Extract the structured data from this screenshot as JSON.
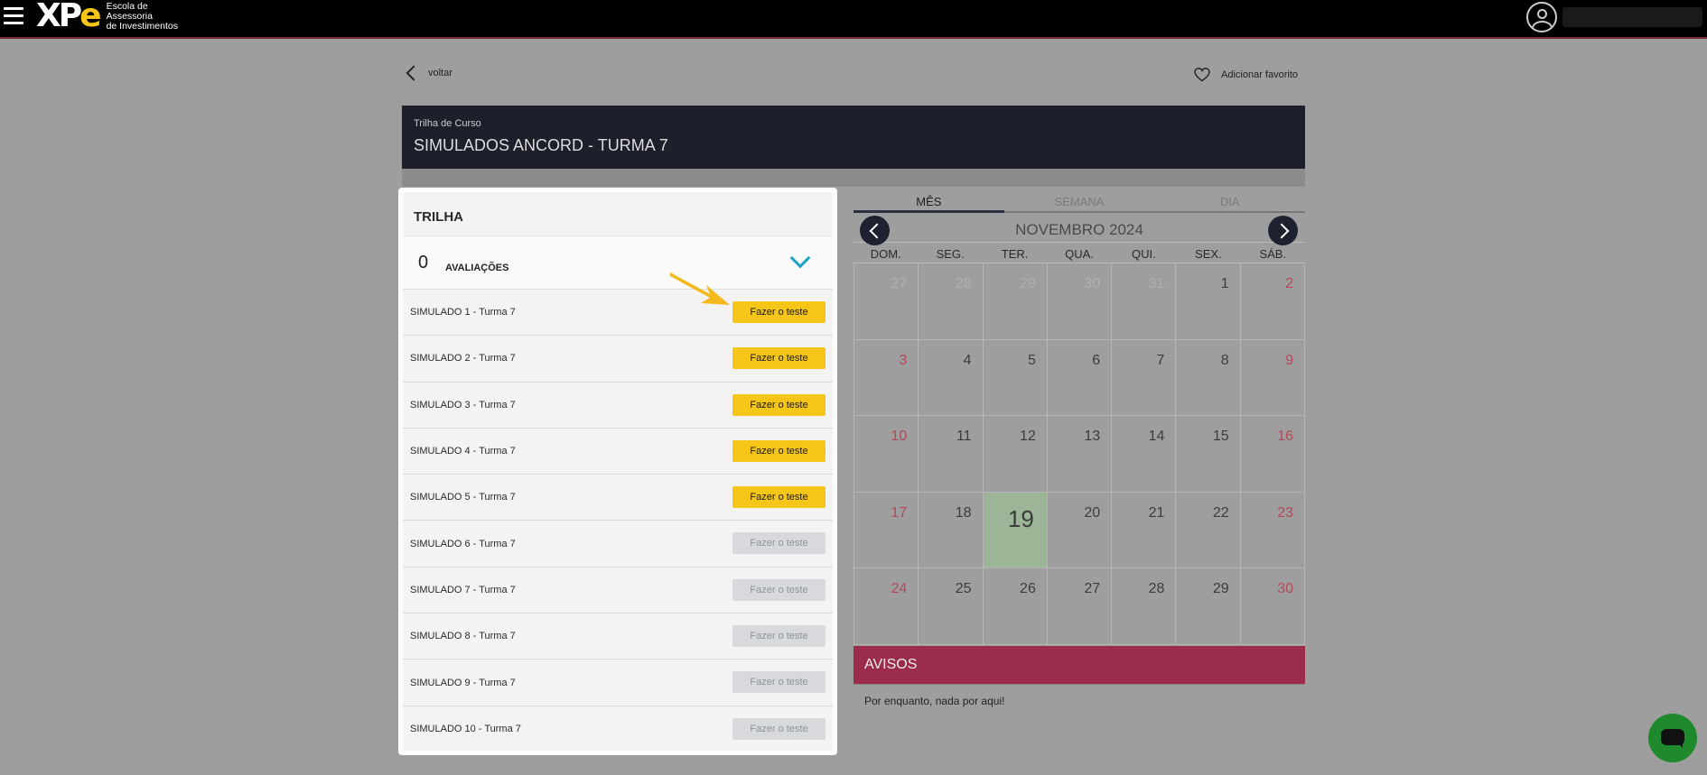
{
  "header": {
    "logo_text": "XPe",
    "logo_subtitle_lines": [
      "Escola de",
      "Assessoria",
      "de Investimentos"
    ]
  },
  "nav": {
    "back_label": "voltar",
    "favorite_label": "Adicionar favorito"
  },
  "course": {
    "subtitle": "Trilha de Curso",
    "title": "SIMULADOS ANCORD - TURMA 7"
  },
  "trilha": {
    "heading": "TRILHA",
    "avaliacoes_count": "0",
    "avaliacoes_label": "AVALIAÇÕES",
    "items": [
      {
        "name": "SIMULADO 1 - Turma 7",
        "button": "Fazer o teste",
        "enabled": true
      },
      {
        "name": "SIMULADO 2 - Turma 7",
        "button": "Fazer o teste",
        "enabled": true
      },
      {
        "name": "SIMULADO 3 - Turma 7",
        "button": "Fazer o teste",
        "enabled": true
      },
      {
        "name": "SIMULADO 4 - Turma 7",
        "button": "Fazer o teste",
        "enabled": true
      },
      {
        "name": "SIMULADO 5 - Turma 7",
        "button": "Fazer o teste",
        "enabled": true
      },
      {
        "name": "SIMULADO 6 - Turma 7",
        "button": "Fazer o teste",
        "enabled": false
      },
      {
        "name": "SIMULADO 7 - Turma 7",
        "button": "Fazer o teste",
        "enabled": false
      },
      {
        "name": "SIMULADO 8 - Turma 7",
        "button": "Fazer o teste",
        "enabled": false
      },
      {
        "name": "SIMULADO 9 - Turma 7",
        "button": "Fazer o teste",
        "enabled": false
      },
      {
        "name": "SIMULADO 10 - Turma 7",
        "button": "Fazer o teste",
        "enabled": false
      }
    ]
  },
  "calendar": {
    "tabs": [
      "MÊS",
      "SEMANA",
      "DIA"
    ],
    "active_tab": "MÊS",
    "month_label": "NOVEMBRO 2024",
    "weekdays": [
      "DOM.",
      "SEG.",
      "TER.",
      "QUA.",
      "QUI.",
      "SEX.",
      "SÁB."
    ],
    "days": [
      {
        "d": "27",
        "muted": true
      },
      {
        "d": "28",
        "muted": true
      },
      {
        "d": "29",
        "muted": true
      },
      {
        "d": "30",
        "muted": true
      },
      {
        "d": "31",
        "muted": true
      },
      {
        "d": "1"
      },
      {
        "d": "2"
      },
      {
        "d": "3"
      },
      {
        "d": "4"
      },
      {
        "d": "5"
      },
      {
        "d": "6"
      },
      {
        "d": "7"
      },
      {
        "d": "8"
      },
      {
        "d": "9"
      },
      {
        "d": "10"
      },
      {
        "d": "11"
      },
      {
        "d": "12"
      },
      {
        "d": "13"
      },
      {
        "d": "14"
      },
      {
        "d": "15"
      },
      {
        "d": "16"
      },
      {
        "d": "17"
      },
      {
        "d": "18"
      },
      {
        "d": "19",
        "today": true
      },
      {
        "d": "20"
      },
      {
        "d": "21"
      },
      {
        "d": "22"
      },
      {
        "d": "23"
      },
      {
        "d": "24"
      },
      {
        "d": "25"
      },
      {
        "d": "26"
      },
      {
        "d": "27"
      },
      {
        "d": "28"
      },
      {
        "d": "29"
      },
      {
        "d": "30"
      }
    ]
  },
  "avisos": {
    "title": "AVISOS",
    "message": "Por enquanto, nada por aqui!"
  },
  "colors": {
    "accent_yellow": "#f5c518",
    "banner": "#1d1f2b",
    "avisos": "#9b2c4b",
    "today": "#9bb596",
    "chat": "#1e8a2d"
  }
}
